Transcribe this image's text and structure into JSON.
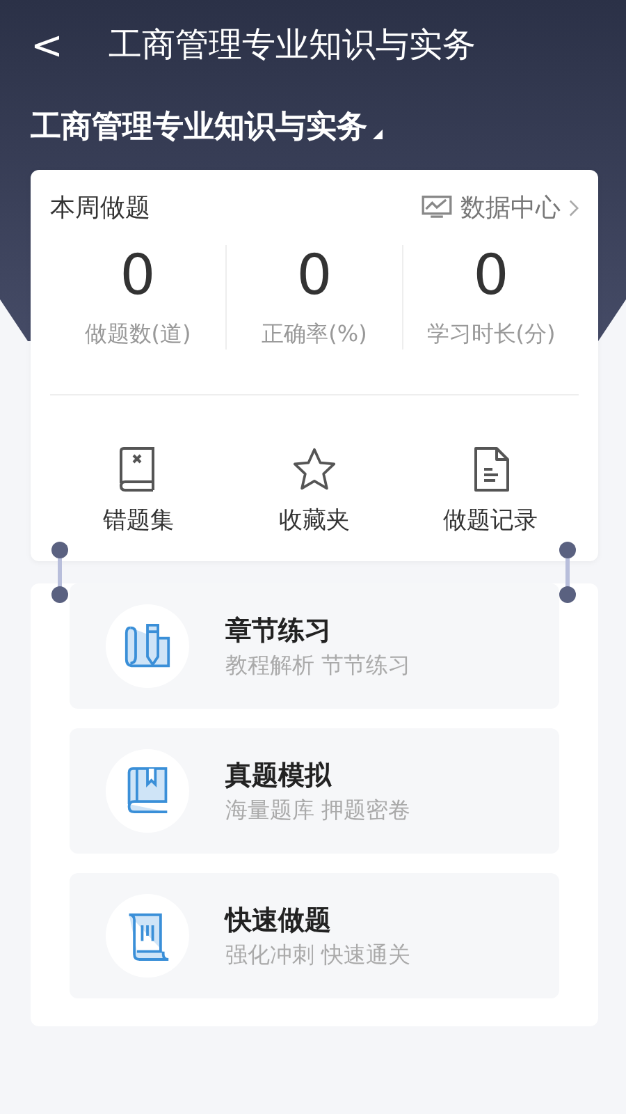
{
  "nav": {
    "back": "<",
    "title": "工商管理专业知识与实务"
  },
  "subject": {
    "label": "工商管理专业知识与实务"
  },
  "weekly": {
    "title": "本周做题",
    "link": "数据中心",
    "stats": [
      {
        "value": "0",
        "label": "做题数(道)"
      },
      {
        "value": "0",
        "label": "正确率(%)"
      },
      {
        "value": "0",
        "label": "学习时长(分)"
      }
    ],
    "shortcuts": [
      {
        "kind": "wrong-book",
        "label": "错题集"
      },
      {
        "kind": "star",
        "label": "收藏夹"
      },
      {
        "kind": "document",
        "label": "做题记录"
      }
    ]
  },
  "practice": [
    {
      "kind": "chapter",
      "title": "章节练习",
      "subtitle": "教程解析 节节练习"
    },
    {
      "kind": "book",
      "title": "真题模拟",
      "subtitle": "海量题库 押题密卷"
    },
    {
      "kind": "scroll",
      "title": "快速做题",
      "subtitle": "强化冲刺 快速通关"
    }
  ]
}
